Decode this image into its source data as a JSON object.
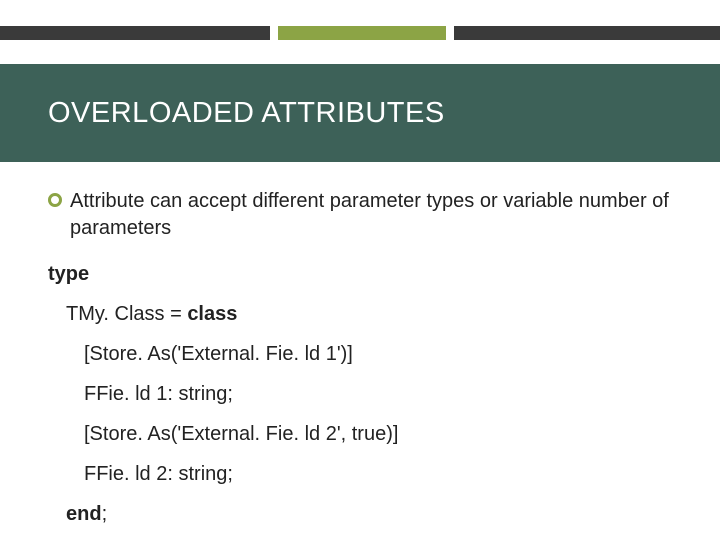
{
  "title": "OVERLOADED ATTRIBUTES",
  "bullet": "Attribute can accept different parameter types or variable number of parameters",
  "code": {
    "kw_type": "type",
    "class_decl_prefix": "TMy. Class = ",
    "kw_class": "class",
    "attr1": "[Store. As('External. Fie. ld 1')]",
    "field1": "FFie. ld 1: string;",
    "attr2": "[Store. As('External. Fie. ld 2', true)]",
    "field2": "FFie. ld 2: string;",
    "kw_end": "end",
    "end_semi": ";"
  }
}
